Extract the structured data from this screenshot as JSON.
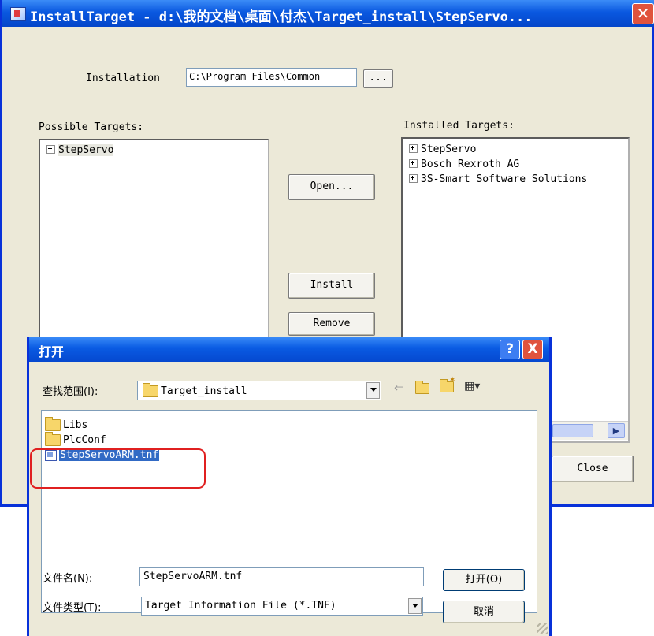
{
  "main": {
    "title": "InstallTarget - d:\\我的文档\\桌面\\付杰\\Target_install\\StepServo...",
    "installation_label": "Installation",
    "installation_value": "C:\\Program Files\\Common",
    "browse_label": "...",
    "possible_targets_label": "Possible Targets:",
    "possible_targets": [
      "StepServo"
    ],
    "installed_targets_label": "Installed Targets:",
    "installed_targets": [
      "StepServo",
      "Bosch Rexroth AG",
      "3S-Smart Software Solutions"
    ],
    "open_button": "Open...",
    "install_button": "Install",
    "remove_button": "Remove",
    "close_button": "Close",
    "close_icon": "close-icon"
  },
  "dialog": {
    "title": "打开",
    "look_in_label": "查找范围(I):",
    "look_in_value": "Target_install",
    "items": [
      {
        "name": "Libs",
        "type": "folder"
      },
      {
        "name": "PlcConf",
        "type": "folder"
      },
      {
        "name": "StepServoARM.tnf",
        "type": "file",
        "selected": true
      }
    ],
    "filename_label": "文件名(N):",
    "filename_value": "StepServoARM.tnf",
    "filetype_label": "文件类型(T):",
    "filetype_value": "Target Information File (*.TNF)",
    "open_button": "打开(O)",
    "cancel_button": "取消",
    "help_button": "?",
    "close_button": "X"
  },
  "colors": {
    "titlebar": "#0a58e0",
    "selection": "#316ac5",
    "annotation_red": "#e02020",
    "window_bg": "#ece9d8"
  }
}
